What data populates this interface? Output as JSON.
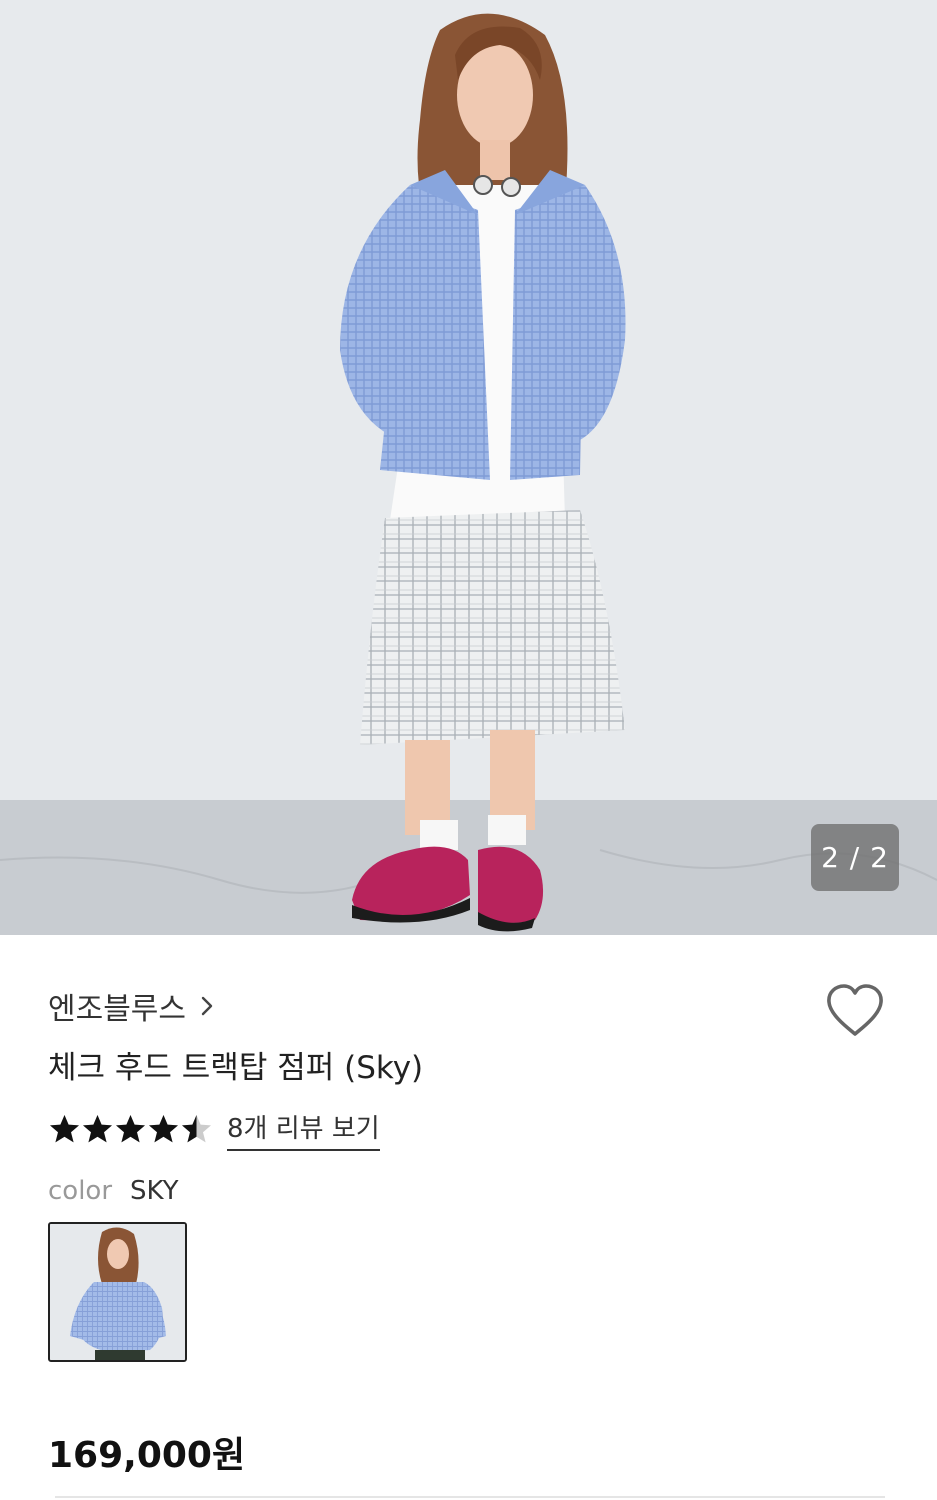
{
  "gallery": {
    "counter": "2 / 2"
  },
  "product": {
    "brand": "엔조블루스",
    "title": "체크 후드 트랙탑 점퍼 (Sky)",
    "rating": 4.5,
    "rating_max": 5,
    "review_link": "8개 리뷰 보기",
    "color_label": "color",
    "color_value": "SKY",
    "price": "169,000원"
  },
  "icons": {
    "brand_chevron": "chevron-right-icon",
    "wishlist": "heart-outline-icon",
    "star_full": "star-filled-icon",
    "star_half": "star-half-icon"
  },
  "colors": {
    "star": "#111111",
    "star_empty": "#cccccc",
    "text_primary": "#222222",
    "text_muted": "#999999"
  }
}
